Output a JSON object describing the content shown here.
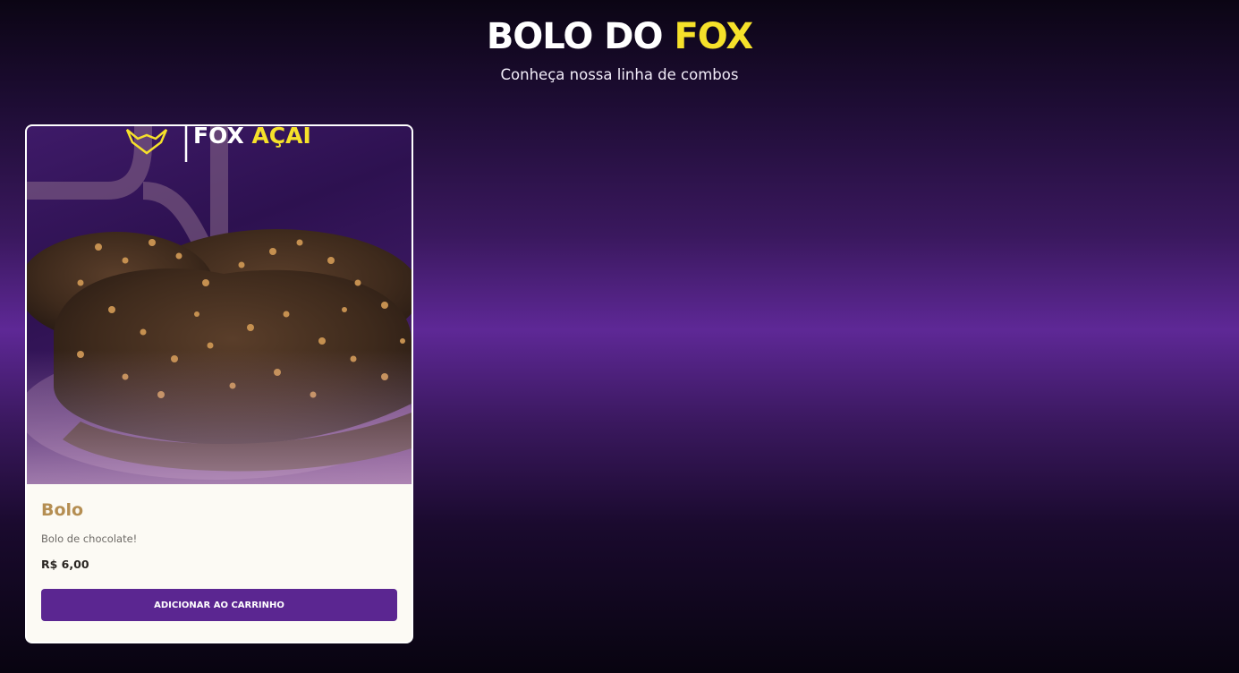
{
  "header": {
    "title_main": "BOLO DO ",
    "title_accent": "FOX",
    "subtitle": "Conheça nossa linha de combos"
  },
  "colors": {
    "accent_yellow": "#f6e12a",
    "brand_purple": "#5b2691",
    "product_name_gold": "#b58e52"
  },
  "product": {
    "image_brand_main": "FOX",
    "image_brand_accent": "AÇAI",
    "name": "Bolo",
    "description": "Bolo de chocolate!",
    "price": "R$ 6,00",
    "button_label": "ADICIONAR AO CARRINHO"
  },
  "icons": {
    "brand_logo": "fox-head-icon"
  }
}
